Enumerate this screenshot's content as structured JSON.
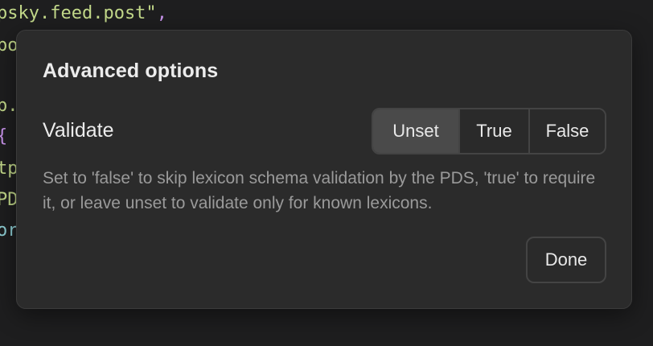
{
  "code_background": {
    "lines": [
      {
        "text": "psky.feed.post\"",
        "trail": ",",
        "color": "#c3d98a"
      },
      {
        "text": "po",
        "trail": "",
        "color": "#c3d98a"
      },
      {
        "text": "",
        "trail": "",
        "color": "#c8c8c8"
      },
      {
        "text": "p.",
        "trail": "",
        "color": "#c3d98a"
      },
      {
        "text": "{",
        "trail": "",
        "color": "#c792ea"
      },
      {
        "text": "tp",
        "trail": "",
        "color": "#c3d98a"
      },
      {
        "text": "PD",
        "trail": "",
        "color": "#c3d98a"
      },
      {
        "text": "or",
        "trail": "",
        "color": "#8fd0d6"
      }
    ]
  },
  "dialog": {
    "title": "Advanced options",
    "validate_label": "Validate",
    "options": [
      {
        "label": "Unset",
        "selected": true
      },
      {
        "label": "True",
        "selected": false
      },
      {
        "label": "False",
        "selected": false
      }
    ],
    "helper_text": "Set to 'false' to skip lexicon schema validation by the PDS, 'true' to require it, or leave unset to validate only for known lexicons.",
    "done_label": "Done"
  }
}
